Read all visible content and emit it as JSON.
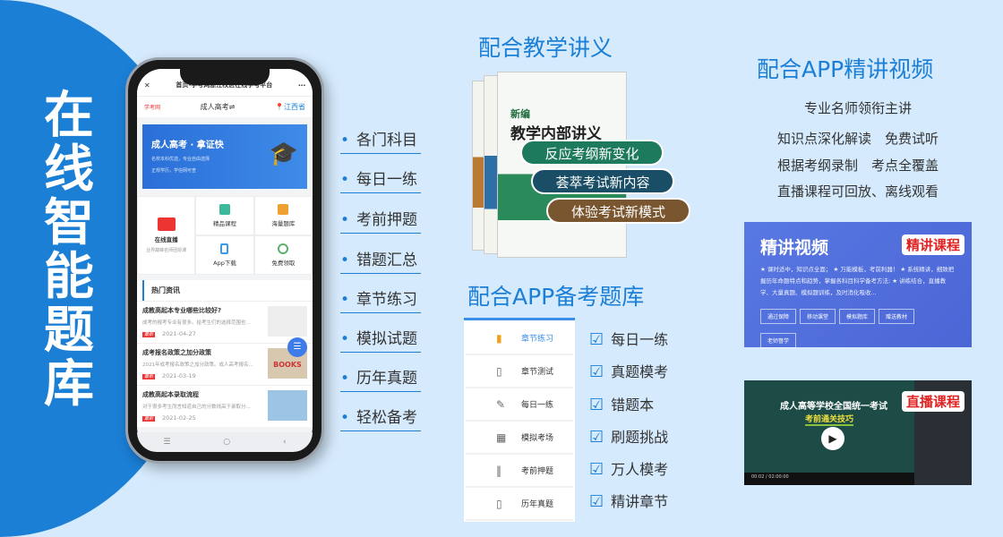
{
  "headline": "在线智能题库",
  "phone": {
    "title": "首页-学考网浙江校区在线学考平台",
    "nav": {
      "logo": "学考网",
      "center": "成人高考⇌",
      "location": "江西省"
    },
    "banner": {
      "title": "成人高考 · 拿证快",
      "sub": "名校本科优选，专业自由选择",
      "badge": "正规学历，学信网可查"
    },
    "grid": [
      {
        "label": "在线直播",
        "sub": "业界巅峰名师团授课"
      },
      {
        "label": "精品课程"
      },
      {
        "label": "海量题库"
      },
      {
        "label": "App下载"
      },
      {
        "label": "免费领取"
      }
    ],
    "news_header": "热门资讯",
    "news": [
      {
        "title": "成教高起本专业哪些比较好?",
        "desc": "成考的报考专业有很多。给考生们的选择范围也...",
        "tag": "最新",
        "date": "2021-04-27"
      },
      {
        "title": "成考报名政策之加分政策",
        "desc": "2021年成考报名政策之加分政策。成人高考报名...",
        "tag": "最新",
        "date": "2021-03-19"
      },
      {
        "title": "成教高起本录取流程",
        "desc": "对于很多考生而言知道自己的分数线高于录取分...",
        "tag": "最新",
        "date": "2021-02-25"
      }
    ],
    "thumb_text": "BOOKS"
  },
  "features": [
    "各门科目",
    "每日一练",
    "考前押题",
    "错题汇总",
    "章节练习",
    "模拟试题",
    "历年真题",
    "轻松备考"
  ],
  "lecture": {
    "title": "配合教学讲义",
    "book_title": "教学内部讲义",
    "book_prefix": "新编",
    "book_spine": "教学内部讲义",
    "pills": [
      "反应考纲新变化",
      "荟萃考试新内容",
      "体验考试新模式"
    ],
    "pill_colors": [
      "#1e7a5c",
      "#1a4e66",
      "#7a5630"
    ]
  },
  "bank": {
    "title": "配合APP备考题库",
    "menu": [
      {
        "label": "章节练习",
        "icon": "book-icon"
      },
      {
        "label": "章节测试",
        "icon": "tablet-icon"
      },
      {
        "label": "每日一练",
        "icon": "pencil-icon"
      },
      {
        "label": "模拟考场",
        "icon": "calendar-icon"
      },
      {
        "label": "考前押题",
        "icon": "books-icon"
      },
      {
        "label": "历年真题",
        "icon": "notebook-icon"
      }
    ],
    "checks": [
      "每日一练",
      "真题模考",
      "错题本",
      "刷题挑战",
      "万人模考",
      "精讲章节"
    ]
  },
  "video": {
    "title": "配合APP精讲视频",
    "lines": [
      "专业名师领衔主讲",
      "知识点深化解读　免费试听",
      "根据考纲录制　考点全覆盖",
      "直播课程可回放、离线观看"
    ],
    "card": {
      "title": "精讲视频",
      "label": "精讲课程",
      "desc": "★ 课时适中，知识点全面； ★ 万能模板，考前利器！ ★ 系统精讲，细致把握历年命题特点和趋势，掌握各科目科学备考方法; ★ 讲练结合，直播教学、大量真题、模拟题训练，及时消化吸收...",
      "tags": [
        "通过保障",
        "移动课堂",
        "模拟题库",
        "赠送教材",
        "老师督学"
      ]
    },
    "live": {
      "label": "直播课程",
      "slide_title": "成人高等学校全国统一考试",
      "slide_sub": "考前通关技巧",
      "time": "00:02 / 02:00:00"
    }
  },
  "accent": "#1b7fd6"
}
